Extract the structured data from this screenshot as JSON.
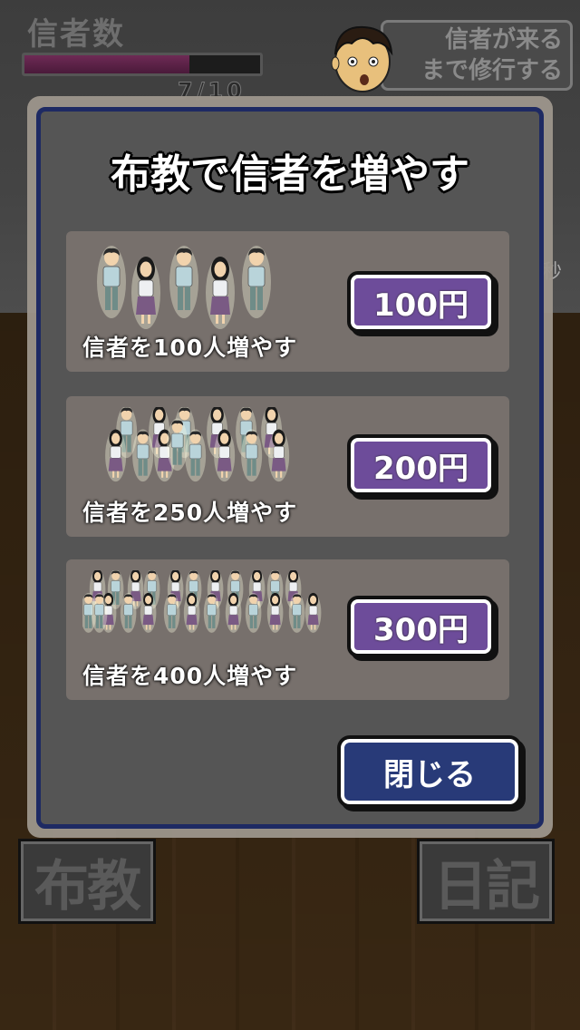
{
  "hud": {
    "title": "信者数",
    "progress_fraction": 0.7,
    "count": "7/10",
    "wait_button_line1": "信者が来る",
    "wait_button_line2": "まで修行する",
    "right_fragment": "秒"
  },
  "modal": {
    "title": "布教で信者を増やす",
    "options": [
      {
        "label": "信者を100人増やす",
        "price": "100円",
        "followers_shown": 5
      },
      {
        "label": "信者を250人増やす",
        "price": "200円",
        "followers_shown": 14
      },
      {
        "label": "信者を400人増やす",
        "price": "300円",
        "followers_shown": 24
      }
    ],
    "close_label": "閉じる"
  },
  "bottom": {
    "left_button": "布教",
    "right_button": "日記"
  },
  "colors": {
    "price_button": "#6d4c9a",
    "close_button": "#283a78",
    "modal_border": "#1e2a63",
    "progress_fill": "#6e2a55"
  }
}
